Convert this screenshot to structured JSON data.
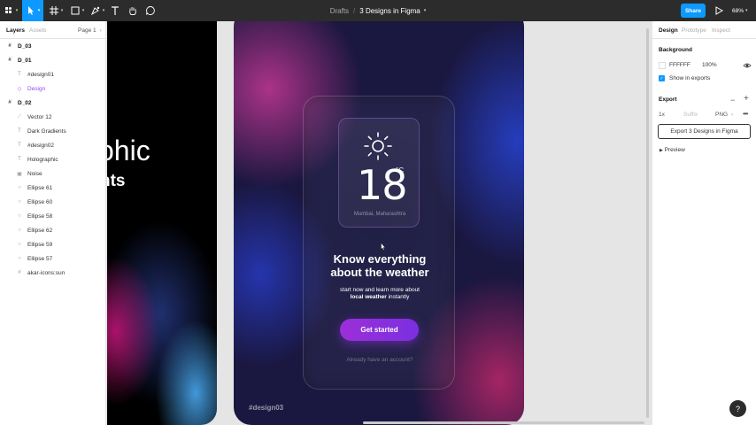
{
  "toolbar": {
    "breadcrumb_project": "Drafts",
    "breadcrumb_separator": "/",
    "file_name": "3 Designs in Figma",
    "share_label": "Share",
    "zoom": "68%"
  },
  "layers_panel": {
    "tabs": [
      "Layers",
      "Assets"
    ],
    "page": "Page 1",
    "items": [
      {
        "label": "D_03",
        "icon": "frame-icon"
      },
      {
        "label": "D_01",
        "icon": "frame-icon"
      },
      {
        "label": "#design01",
        "icon": "text-icon"
      },
      {
        "label": "Design",
        "icon": "component-icon"
      },
      {
        "label": "D_02",
        "icon": "frame-icon"
      },
      {
        "label": "Vector 12",
        "icon": "vector-icon"
      },
      {
        "label": "Dark Gradients",
        "icon": "text-icon"
      },
      {
        "label": "#design02",
        "icon": "text-icon"
      },
      {
        "label": "Holographic",
        "icon": "text-icon"
      },
      {
        "label": "Noise",
        "icon": "image-icon"
      },
      {
        "label": "Ellipse 61",
        "icon": "ellipse-icon"
      },
      {
        "label": "Ellipse 60",
        "icon": "ellipse-icon"
      },
      {
        "label": "Ellipse 58",
        "icon": "ellipse-icon"
      },
      {
        "label": "Ellipse 62",
        "icon": "ellipse-icon"
      },
      {
        "label": "Ellipse 59",
        "icon": "ellipse-icon"
      },
      {
        "label": "Ellipse 57",
        "icon": "ellipse-icon"
      },
      {
        "label": "akar-icons:sun",
        "icon": "group-icon"
      }
    ]
  },
  "canvas": {
    "d01_title": "ohic",
    "d01_subtitle": "nts",
    "design_label": "#design03",
    "weather": {
      "temperature": "18",
      "unit": "°C",
      "location": "Mumbai, Maharashtra"
    },
    "headline_line1": "Know everything",
    "headline_line2": "about the weather",
    "subtext_line1": "start now and learn more about",
    "subtext_bold": "local weather",
    "subtext_rest": " instantly",
    "cta_label": "Get started",
    "account_text": "Already have an account?"
  },
  "design_panel": {
    "tabs": [
      "Design",
      "Prototype",
      "Inspect"
    ],
    "background_title": "Background",
    "background_hex": "FFFFFF",
    "background_opacity": "100%",
    "show_in_exports": "Show in exports",
    "export_title": "Export",
    "export_scale": "1x",
    "export_suffix_placeholder": "Suffix",
    "export_format": "PNG",
    "export_button": "Export 3 Designs in Figma",
    "preview_label": "Preview"
  },
  "help_label": "?",
  "colors": {
    "accent": "#0d99ff",
    "toolbar_bg": "#2c2c2c",
    "component_purple": "#9747ff",
    "cta_purple": "#8a2fdc"
  }
}
